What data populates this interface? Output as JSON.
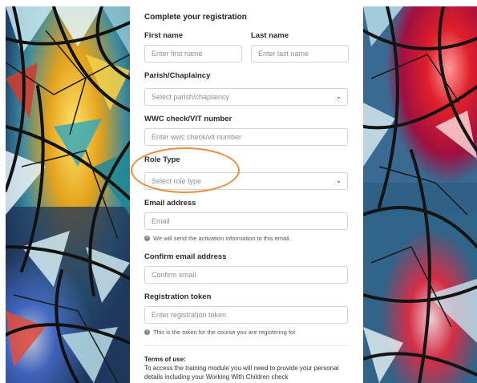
{
  "form": {
    "title": "Complete your registration",
    "first_name": {
      "label": "First name",
      "placeholder": "Enter first name"
    },
    "last_name": {
      "label": "Last name",
      "placeholder": "Enter last name"
    },
    "parish": {
      "label": "Parish/Chaplaincy",
      "selected": "Select parish/chaplaincy"
    },
    "wwc": {
      "label": "WWC check/VIT number",
      "placeholder": "Enter wwc check/vit number"
    },
    "role": {
      "label": "Role Type",
      "selected": "Select role type"
    },
    "email": {
      "label": "Email address",
      "placeholder": "Email",
      "hint": "We will send the activation information to this email."
    },
    "confirm_email": {
      "label": "Confirm email address",
      "placeholder": "Confirm email"
    },
    "token": {
      "label": "Registration token",
      "placeholder": "Enter registration token",
      "hint": "This is the token for the course you are registering for."
    },
    "terms": {
      "title": "Terms of use:",
      "text": "To access the training module you will need to provide your personal details including your Working With Children check"
    }
  },
  "icons": {
    "select_chevron": "chevron-down-icon",
    "hint": "info-icon"
  },
  "colors": {
    "highlight": "#ef8a3b",
    "input_border": "#cfd4da"
  }
}
